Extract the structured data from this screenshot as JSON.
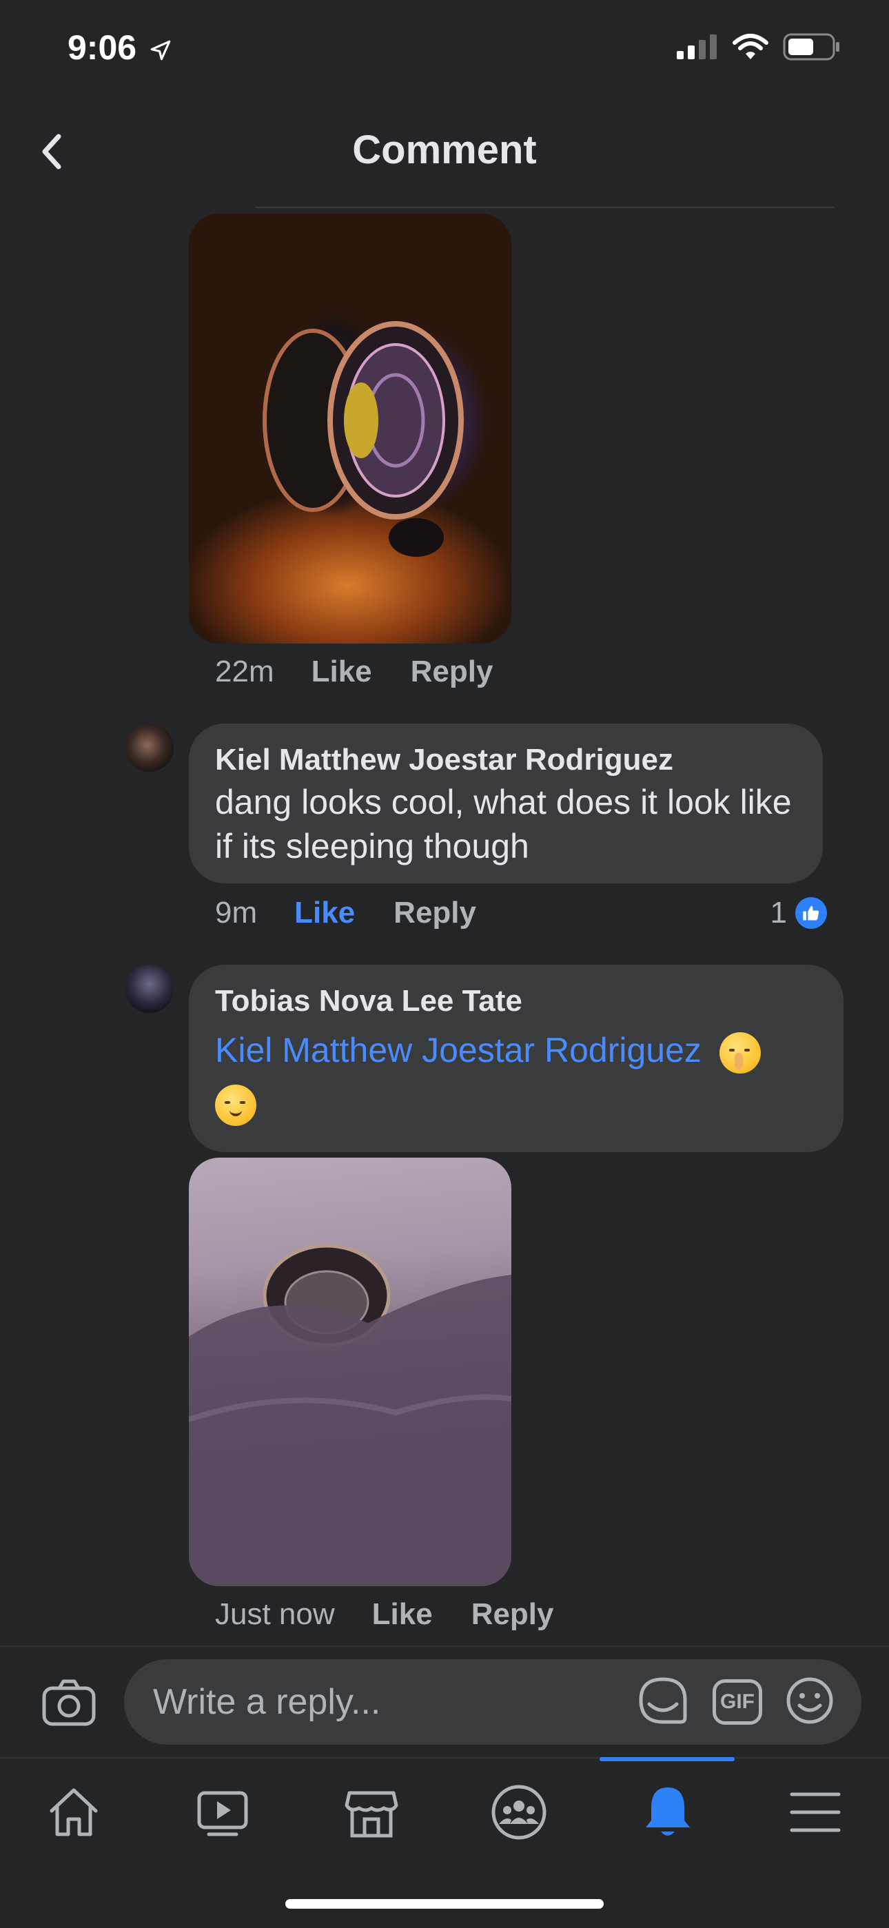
{
  "status_bar": {
    "time": "9:06"
  },
  "header": {
    "title": "Comment"
  },
  "comments": [
    {
      "meta": {
        "time": "22m",
        "like_label": "Like",
        "reply_label": "Reply"
      }
    },
    {
      "author": "Kiel Matthew Joestar Rodriguez",
      "text": "dang looks cool, what does it look like if its sleeping though",
      "meta": {
        "time": "9m",
        "like_label": "Like",
        "reply_label": "Reply"
      },
      "reaction_count": "1"
    },
    {
      "author": "Tobias Nova Lee Tate",
      "mention": "Kiel Matthew Joestar Rodriguez",
      "meta": {
        "time": "Just now",
        "like_label": "Like",
        "reply_label": "Reply"
      }
    }
  ],
  "composer": {
    "placeholder": "Write a reply...",
    "gif_label": "GIF"
  },
  "tabs": [
    "home-icon",
    "video-icon",
    "marketplace-icon",
    "groups-icon",
    "notifications-icon",
    "menu-icon"
  ],
  "colors": {
    "accent": "#2e81f7",
    "background": "#242526",
    "bubble": "#3a3b3c",
    "mention": "#4a8bff"
  }
}
